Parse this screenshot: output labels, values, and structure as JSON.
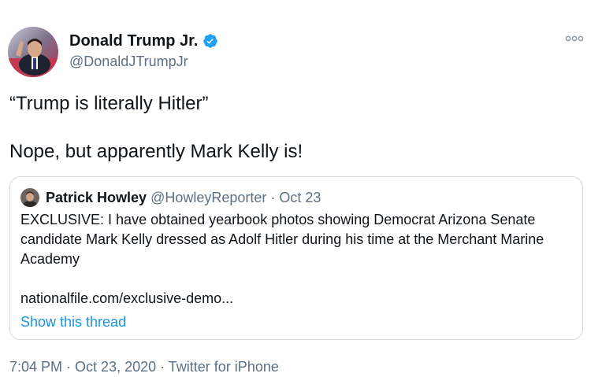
{
  "author": {
    "name": "Donald Trump Jr.",
    "handle": "@DonaldJTrumpJr"
  },
  "icons": {
    "verified": "verified-badge-icon",
    "more": "more-options-icon"
  },
  "colors": {
    "verified_blue": "#1da1f2",
    "link_blue": "#1b95e0",
    "secondary_text": "#5b7083",
    "border": "#cfd9de"
  },
  "tweet": {
    "line1": "“Trump is literally Hitler”",
    "line2": "Nope, but apparently Mark Kelly is!"
  },
  "quote": {
    "name": "Patrick Howley",
    "handle": "@HowleyReporter",
    "separator": " · ",
    "date": "Oct 23",
    "body": "EXCLUSIVE: I have obtained yearbook photos showing Democrat Arizona Senate candidate Mark Kelly dressed as Adolf Hitler during his time at the Merchant Marine Academy",
    "link": "nationalfile.com/exclusive-demo...",
    "thread_label": "Show this thread"
  },
  "footer": {
    "time": "7:04 PM",
    "sep1": " · ",
    "date": "Oct 23, 2020",
    "sep2": " · ",
    "source": "Twitter for iPhone"
  }
}
